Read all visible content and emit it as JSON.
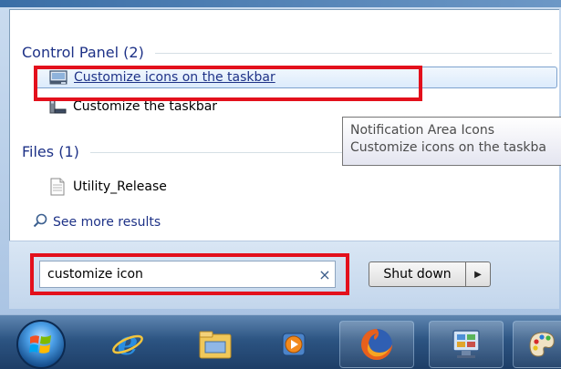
{
  "start_menu": {
    "groups": [
      {
        "title": "Control Panel (2)"
      },
      {
        "title": "Files (1)"
      }
    ],
    "control_panel_results": [
      {
        "label": "Customize icons on the taskbar",
        "icon": "notification-area-icon"
      },
      {
        "label": "Customize the taskbar",
        "icon": "taskbar-settings-icon"
      }
    ],
    "file_results": [
      {
        "label": "Utility_Release",
        "icon": "text-file-icon"
      }
    ],
    "see_more": "See more results",
    "tooltip": {
      "line1": "Notification Area Icons",
      "line2": "Customize icons on the taskba"
    },
    "search": {
      "value": "customize icon",
      "clear": "×"
    },
    "shutdown": {
      "label": "Shut down",
      "arrow": "▶"
    }
  },
  "taskbar": {
    "start_icon": "windows-start-orb",
    "pinned": [
      "internet-explorer-icon",
      "windows-explorer-icon",
      "media-player-icon",
      "firefox-icon",
      "control-panel-icon",
      "paint-icon"
    ]
  },
  "colors": {
    "highlight": "#e3101c",
    "link_blue": "#1e3287",
    "selection": "#dcebfc"
  }
}
